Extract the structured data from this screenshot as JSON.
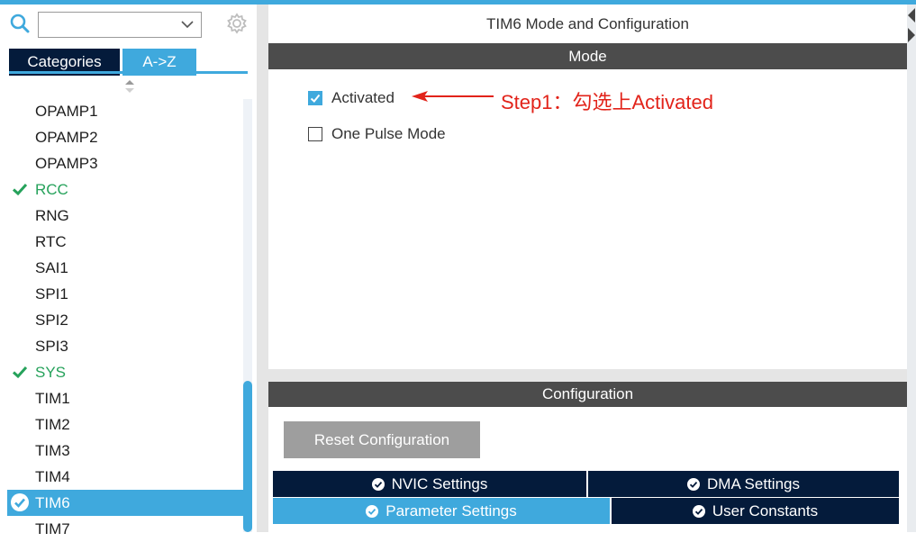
{
  "sidebar": {
    "search": {
      "value": "",
      "placeholder": ""
    },
    "tabs": {
      "categories": "Categories",
      "az": "A->Z"
    },
    "items": [
      {
        "label": "OPAMP1",
        "state": "normal"
      },
      {
        "label": "OPAMP2",
        "state": "normal"
      },
      {
        "label": "OPAMP3",
        "state": "normal"
      },
      {
        "label": "RCC",
        "state": "ok"
      },
      {
        "label": "RNG",
        "state": "normal"
      },
      {
        "label": "RTC",
        "state": "normal"
      },
      {
        "label": "SAI1",
        "state": "normal"
      },
      {
        "label": "SPI1",
        "state": "normal"
      },
      {
        "label": "SPI2",
        "state": "normal"
      },
      {
        "label": "SPI3",
        "state": "normal"
      },
      {
        "label": "SYS",
        "state": "ok"
      },
      {
        "label": "TIM1",
        "state": "normal"
      },
      {
        "label": "TIM2",
        "state": "normal"
      },
      {
        "label": "TIM3",
        "state": "normal"
      },
      {
        "label": "TIM4",
        "state": "normal"
      },
      {
        "label": "TIM6",
        "state": "selected"
      },
      {
        "label": "TIM7",
        "state": "normal"
      }
    ]
  },
  "main": {
    "title": "TIM6 Mode and Configuration",
    "mode": {
      "header": "Mode",
      "options": [
        {
          "label": "Activated",
          "checked": true
        },
        {
          "label": "One Pulse Mode",
          "checked": false
        }
      ],
      "annotation": "Step1：勾选上Activated"
    },
    "configuration": {
      "header": "Configuration",
      "reset_label": "Reset Configuration",
      "tabs": {
        "nvic": "NVIC Settings",
        "dma": "DMA Settings",
        "parameter": "Parameter Settings",
        "user": "User Constants"
      }
    }
  },
  "colors": {
    "accent": "#3fa9dd",
    "navy": "#041b3b",
    "header_gray": "#4c4c4c",
    "ok_green": "#26a25b",
    "annotation_red": "#e2231a"
  }
}
